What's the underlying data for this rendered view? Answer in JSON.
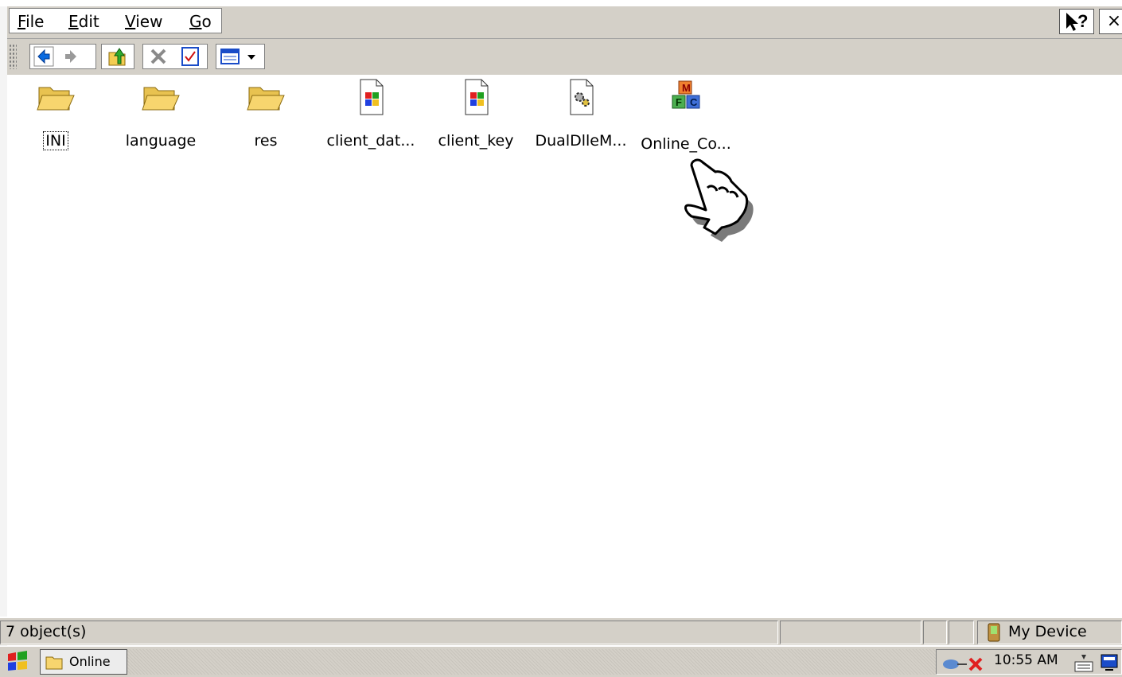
{
  "menu": {
    "file": {
      "accel": "F",
      "rest": "ile"
    },
    "edit": {
      "accel": "E",
      "rest": "dit"
    },
    "view": {
      "accel": "V",
      "rest": "iew"
    },
    "go": {
      "accel": "G",
      "rest": "o"
    }
  },
  "titlebar": {
    "help_label": "?",
    "close_label": "×"
  },
  "files": [
    {
      "label": "INI",
      "type": "folder"
    },
    {
      "label": "language",
      "type": "folder"
    },
    {
      "label": "res",
      "type": "folder"
    },
    {
      "label": "client_dat...",
      "type": "windows-file"
    },
    {
      "label": "client_key",
      "type": "windows-file"
    },
    {
      "label": "DualDlleM...",
      "type": "dll-file"
    },
    {
      "label": "Online_Co...",
      "type": "mfc-application"
    }
  ],
  "status": {
    "objects": "7 object(s)",
    "location": "My Device"
  },
  "taskbar": {
    "task_label": "Online",
    "clock": "10:55 AM"
  },
  "colors": {
    "chrome": "#d4d0c8",
    "folder": "#f7d56e",
    "accent_blue": "#0a3eb0"
  }
}
